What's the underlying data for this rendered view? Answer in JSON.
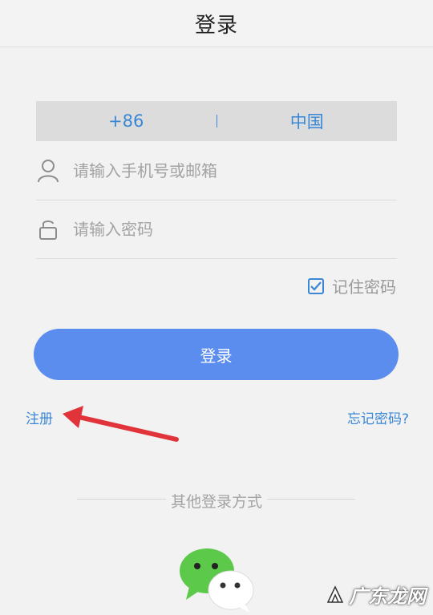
{
  "header": {
    "title": "登录"
  },
  "region": {
    "code": "+86",
    "country": "中国"
  },
  "form": {
    "account_placeholder": "请输入手机号或邮箱",
    "password_placeholder": "请输入密码",
    "remember_label": "记住密码",
    "remember_checked": true,
    "login_label": "登录"
  },
  "links": {
    "register": "注册",
    "forgot": "忘记密码?"
  },
  "other": {
    "label": "其他登录方式",
    "wechat_icon": "wechat-icon"
  },
  "watermark": {
    "text": "广东龙网"
  },
  "colors": {
    "accent": "#3a87d6",
    "button": "#5b8def",
    "arrow": "#e0343a",
    "wechat_green": "#5cc94a"
  }
}
